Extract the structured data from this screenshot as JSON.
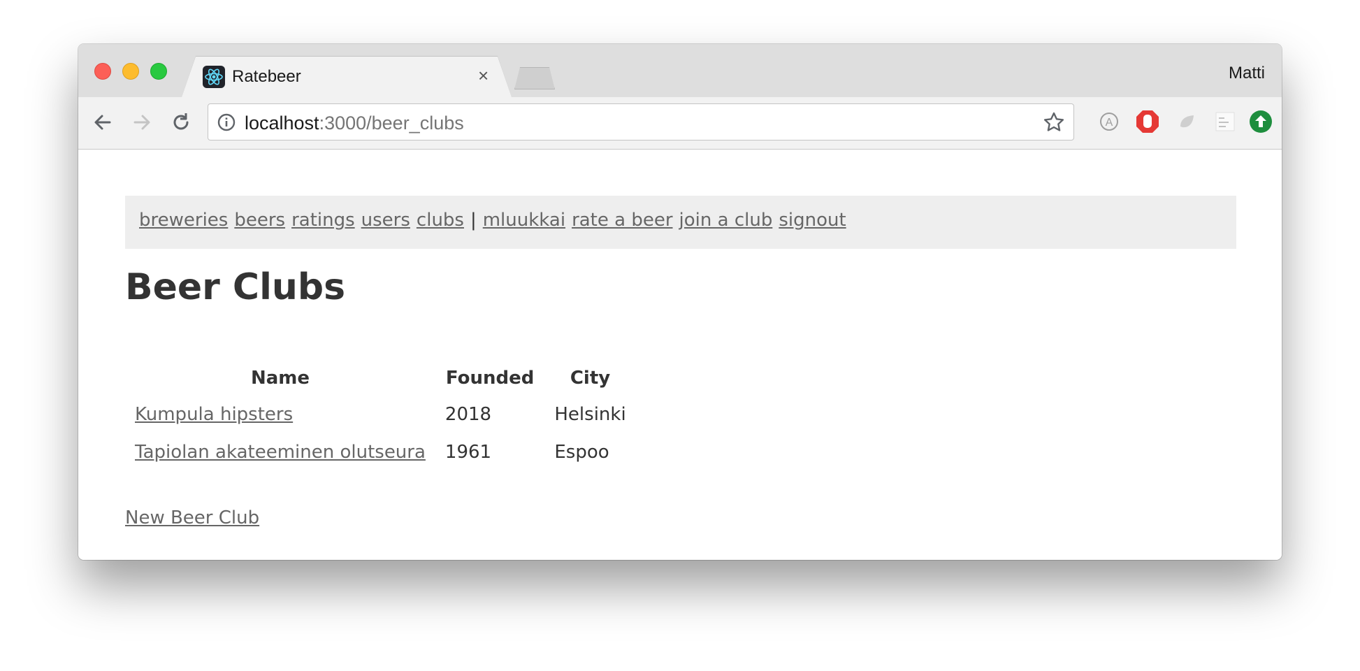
{
  "browser": {
    "tab_title": "Ratebeer",
    "tab_close": "×",
    "profile_name": "Matti",
    "url_host": "localhost",
    "url_path": ":3000/beer_clubs",
    "icons": [
      "back-arrow-icon",
      "forward-arrow-icon",
      "reload-icon",
      "info-icon",
      "star-icon",
      "translate-icon",
      "adblock-icon",
      "shield-icon",
      "notes-icon",
      "upload-icon"
    ]
  },
  "nav": {
    "breweries": "breweries",
    "beers": "beers",
    "ratings": "ratings",
    "users": "users",
    "clubs": "clubs",
    "separator": "|",
    "user": "mluukkai",
    "rate": "rate a beer",
    "join": "join a club",
    "signout": "signout"
  },
  "page": {
    "title": "Beer Clubs",
    "new_link": "New Beer Club"
  },
  "table": {
    "headers": [
      "Name",
      "Founded",
      "City"
    ],
    "rows": [
      [
        "Kumpula hipsters",
        "2018",
        "Helsinki"
      ],
      [
        "Tapiolan akateeminen olutseura",
        "1961",
        "Espoo"
      ]
    ]
  }
}
